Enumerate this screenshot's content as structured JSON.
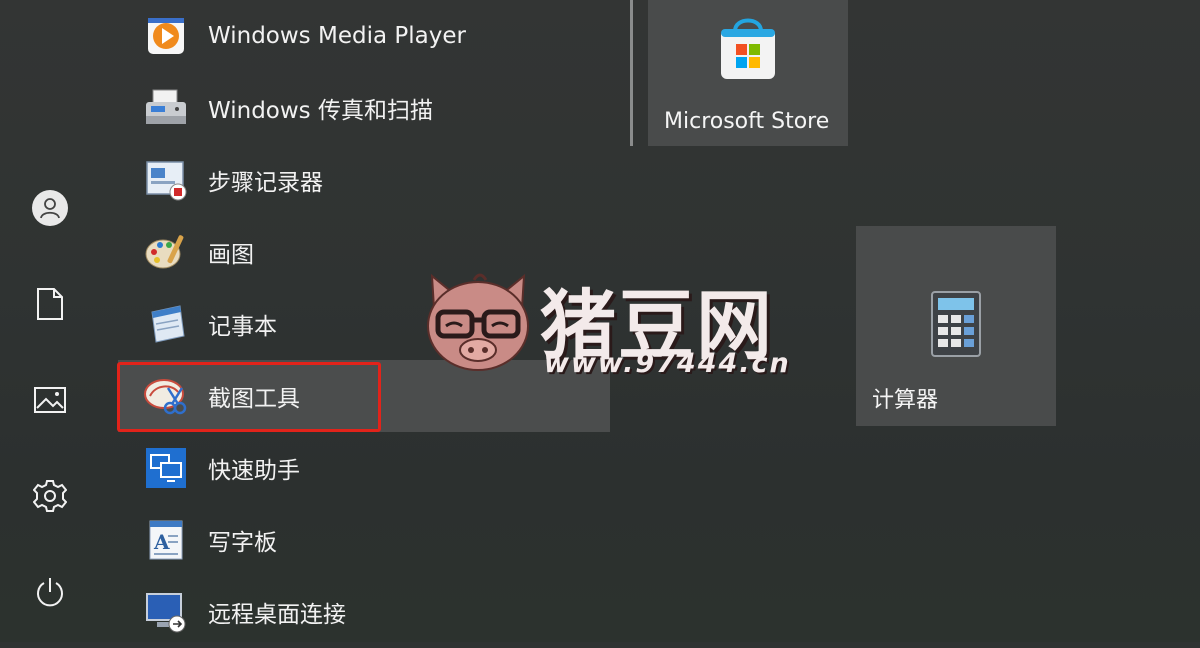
{
  "start_menu": {
    "apps": [
      {
        "label": "Windows Media Player",
        "icon": "media-player-icon"
      },
      {
        "label": "Windows 传真和扫描",
        "icon": "fax-scan-icon"
      },
      {
        "label": "步骤记录器",
        "icon": "steps-recorder-icon"
      },
      {
        "label": "画图",
        "icon": "paint-icon"
      },
      {
        "label": "记事本",
        "icon": "notepad-icon"
      },
      {
        "label": "截图工具",
        "icon": "snipping-tool-icon"
      },
      {
        "label": "快速助手",
        "icon": "quick-assist-icon"
      },
      {
        "label": "写字板",
        "icon": "wordpad-icon"
      },
      {
        "label": "远程桌面连接",
        "icon": "remote-desktop-icon"
      }
    ],
    "selected_index": 5,
    "highlight_color": "#e2231a"
  },
  "rail": {
    "items": [
      "user-icon",
      "document-icon",
      "pictures-icon",
      "settings-icon",
      "power-icon"
    ]
  },
  "tiles": {
    "store": {
      "label": "Microsoft Store",
      "icon": "store-bag-icon"
    },
    "calculator": {
      "label": "计算器",
      "icon": "calculator-icon"
    }
  },
  "watermark": {
    "title": "猪豆网",
    "url": "www.97444.cn"
  },
  "colors": {
    "background": "#2f3332",
    "tile": "#494b4b",
    "selected": "#4b4d4d"
  }
}
